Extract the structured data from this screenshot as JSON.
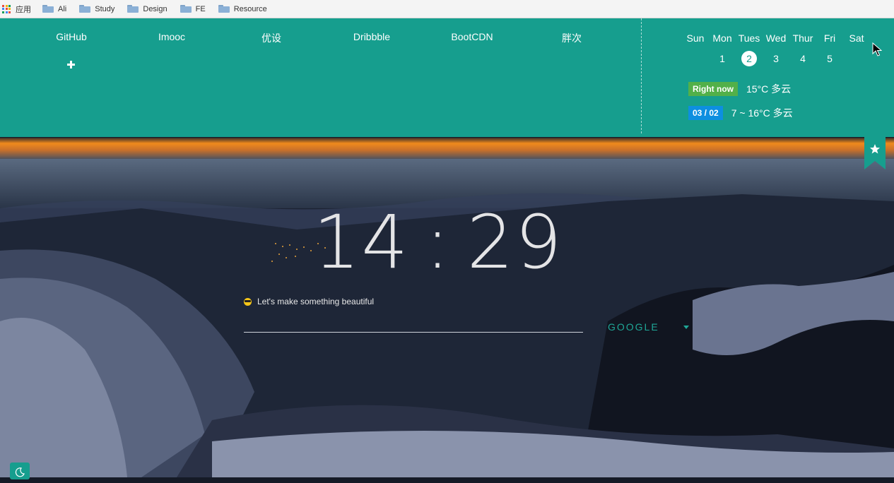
{
  "bookmarks_bar": {
    "apps_label": "应用",
    "folders": [
      "Ali",
      "Study",
      "Design",
      "FE",
      "Resource"
    ]
  },
  "quick_links": [
    "GitHub",
    "Imooc",
    "优设",
    "Dribbble",
    "BootCDN",
    "胖次"
  ],
  "calendar": {
    "weekdays": [
      "Sun",
      "Mon",
      "Tues",
      "Wed",
      "Thur",
      "Fri",
      "Sat"
    ],
    "dates": [
      "",
      "1",
      "2",
      "3",
      "4",
      "5",
      ""
    ],
    "today": "2"
  },
  "weather": {
    "now_tag": "Right now",
    "now_value": "15°C 多云",
    "date_tag": "03 / 02",
    "date_value": "7 ~ 16°C 多云"
  },
  "clock": {
    "hours": "14",
    "minutes": "29"
  },
  "motto": "Let's make something beautiful",
  "search": {
    "value": "",
    "engine": "GOOGLE"
  },
  "colors": {
    "panel": "#169e8e",
    "accent": "#1fa797",
    "tag_green": "#52b049",
    "tag_blue": "#0d8fe0"
  }
}
